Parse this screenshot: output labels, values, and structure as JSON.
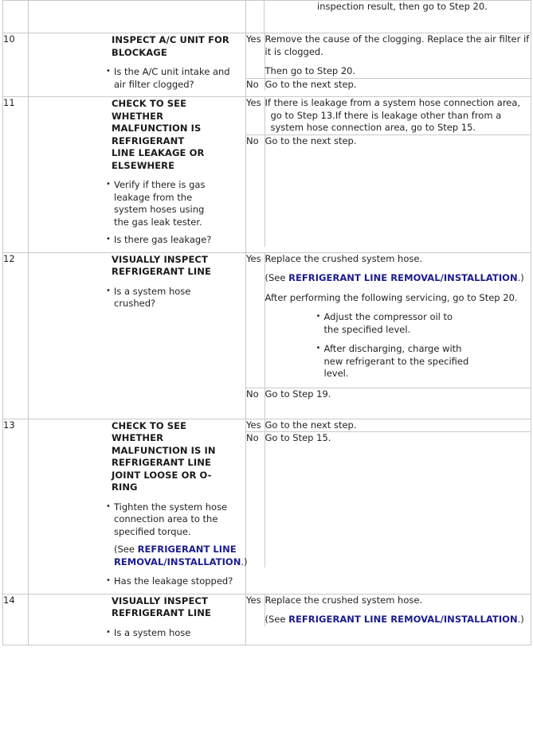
{
  "document": {
    "type": "diagnostic-flow-table",
    "link_color": "#1b1c8c",
    "text_color": "#231f20",
    "border_color": "#c9c9c9"
  },
  "labels": {
    "yes": "Yes",
    "no": "No"
  },
  "partial_row_top": {
    "result_text": "inspection result, then go to Step 20."
  },
  "rows": [
    {
      "step": "10",
      "heading": "INSPECT A/C UNIT FOR BLOCKAGE",
      "bullets": [
        "Is the A/C unit intake and air filter clogged?"
      ],
      "yes": {
        "paragraphs": [
          "Remove the cause of the clogging. Replace the air filter if it is clogged.",
          "Then go to Step 20."
        ]
      },
      "no": {
        "paragraphs": [
          "Go to the next step."
        ]
      }
    },
    {
      "step": "11",
      "heading": "CHECK TO SEE WHETHER MALFUNCTION IS REFRIGERANT LINE LEAKAGE OR ELSEWHERE",
      "bullets": [
        "Verify if there is gas leakage from the system hoses using the gas leak tester.",
        "Is there gas leakage?"
      ],
      "yes": {
        "paragraphs": [
          "If there is leakage from a system hose connection area, go to Step 13.If there is leakage other than from a system hose connection area, go to Step 15."
        ]
      },
      "no": {
        "paragraphs": [
          "Go to the next step."
        ]
      }
    },
    {
      "step": "12",
      "heading": "VISUALLY INSPECT REFRIGERANT LINE",
      "bullets": [
        "Is a system hose crushed?"
      ],
      "yes": {
        "paragraphs": [
          "Replace the crushed system hose."
        ],
        "see_prefix": "(See ",
        "see_link": "REFRIGERANT LINE REMOVAL/INSTALLATION",
        "see_suffix": ".)",
        "after_paragraph": "After performing the following servicing, go to Step 20.",
        "sub_bullets": [
          "Adjust the compressor oil to the specified level.",
          "After discharging, charge with new refrigerant to the specified level."
        ]
      },
      "no": {
        "paragraphs": [
          "Go to Step 19."
        ]
      }
    },
    {
      "step": "13",
      "heading": "CHECK TO SEE WHETHER MALFUNCTION IS IN REFRIGERANT LINE JOINT LOOSE OR O-RING",
      "bullets": [
        "Tighten the system hose connection area to the specified torque."
      ],
      "note_see_prefix": "(See ",
      "note_see_link": "REFRIGERANT LINE REMOVAL/INSTALLATION",
      "note_see_suffix": ".)",
      "bullets_after": [
        "Has the leakage stopped?"
      ],
      "yes": {
        "paragraphs": [
          "Go to the next step."
        ]
      },
      "no": {
        "paragraphs": [
          "Go to Step 15."
        ]
      }
    },
    {
      "step": "14",
      "heading": "VISUALLY INSPECT REFRIGERANT LINE",
      "bullets": [
        "Is a system hose"
      ],
      "yes": {
        "paragraphs": [
          "Replace the crushed system hose."
        ],
        "see_prefix": "(See ",
        "see_link": "REFRIGERANT LINE REMOVAL/INSTALLATION",
        "see_suffix": ".)"
      }
    }
  ]
}
